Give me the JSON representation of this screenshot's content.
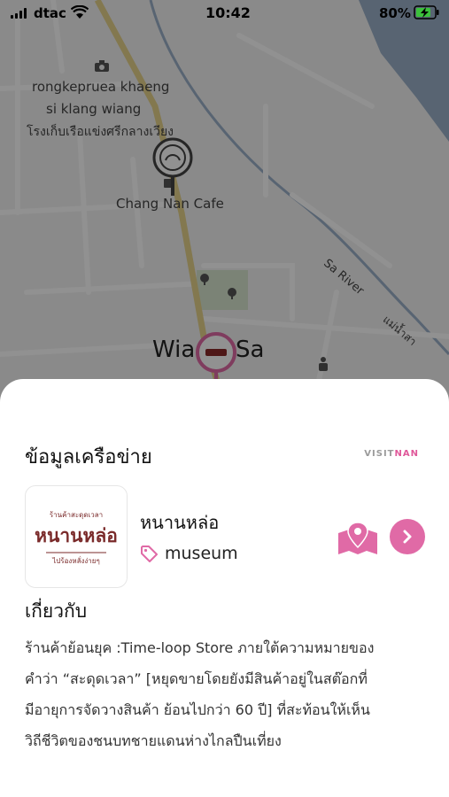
{
  "status_bar": {
    "carrier": "dtac",
    "time": "10:42",
    "battery_percent": "80%",
    "battery_level": 0.8,
    "charging": true
  },
  "map": {
    "labels": {
      "landmark_en_line1": "rongkepruea khaeng",
      "landmark_en_line2": "si klang wiang",
      "landmark_th": "โรงเก็บเรือแข่งศรีกลางเวียง",
      "cafe": "Chang Nan Cafe",
      "river": "Sa River",
      "river_th": "แม่น้ำสา",
      "area_left": "Wia",
      "area_right": "Sa"
    },
    "colors": {
      "water": "#9bb0c8",
      "road_main": "#e6d48c",
      "roads": "#ffffff",
      "park": "#d9e6cf"
    }
  },
  "sheet": {
    "title": "ข้อมูลเครือข่าย",
    "brand_part1": "VISIT",
    "brand_part2": "NAN",
    "place": {
      "name": "หนานหล่อ",
      "category": "museum",
      "logo_text_top": "ร้านค้าสะดุดเวลา",
      "logo_text_main": "หนานหล่อ",
      "logo_text_bottom": "ไปร้องหลั่งง่ายๆ"
    },
    "about_heading": "เกี่ยวกับ",
    "about_lines": [
      "ร้านค้าย้อนยุค :Time-loop Store ภายใต้ความหมายของ",
      "คำว่า “สะดุดเวลา” [หยุดขายโดยยังมีสินค้าอยู่ในสต๊อกที่",
      "มีอายุการจัดวางสินค้า ย้อนไปกว่า 60 ปี] ที่สะท้อนให้เห็น",
      "วิถีชีวิตของชนบทชายแดนห่างไกลปืนเที่ยง"
    ],
    "accent_color": "#e06aa6"
  }
}
